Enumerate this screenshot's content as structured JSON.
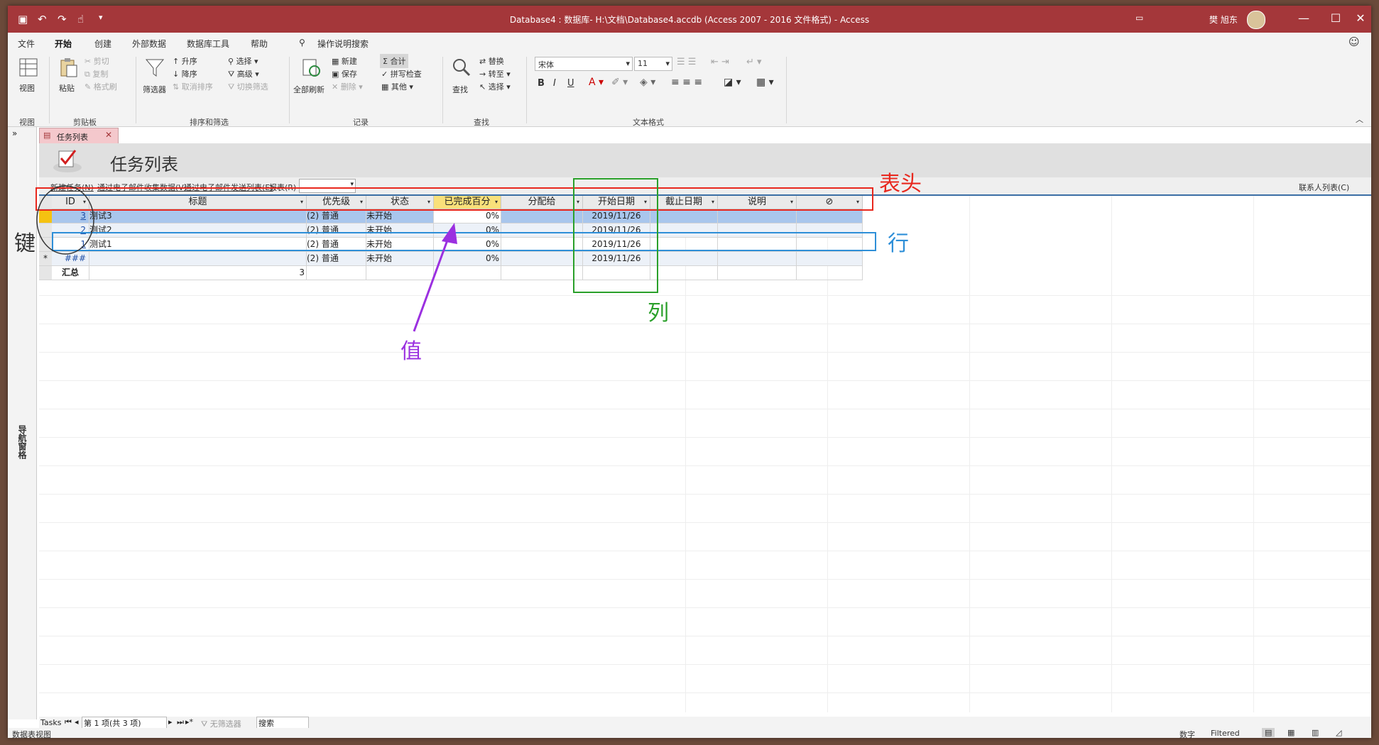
{
  "window": {
    "title": "Database4 : 数据库- H:\\文档\\Database4.accdb (Access 2007 - 2016 文件格式)  -  Access",
    "user": "樊 旭东"
  },
  "ribbon_tabs": [
    "文件",
    "开始",
    "创建",
    "外部数据",
    "数据库工具",
    "帮助"
  ],
  "tell_me": "操作说明搜索",
  "ribbon": {
    "view": "视图",
    "paste": "粘贴",
    "cut": "剪切",
    "copy": "复制",
    "format_painter": "格式刷",
    "filter": "筛选器",
    "ascending": "升序",
    "descending": "降序",
    "remove_sort": "取消排序",
    "selection": "选择",
    "advanced": "高级",
    "toggle_filter": "切换筛选",
    "refresh_all": "全部刷新",
    "new": "新建",
    "save": "保存",
    "delete": "删除",
    "totals": "合计",
    "spelling": "拼写检查",
    "more": "其他",
    "find": "查找",
    "replace": "替换",
    "goto": "转至",
    "select": "选择",
    "font": "宋体",
    "font_size": "11",
    "groups": {
      "views": "视图",
      "clipboard": "剪贴板",
      "sort_filter": "排序和筛选",
      "records": "记录",
      "find": "查找",
      "text_format": "文本格式"
    }
  },
  "document_tab": "任务列表",
  "form_title": "任务列表",
  "nav_pane_label": "导航窗格",
  "subbar": {
    "new_task": "新建任务(N)",
    "collect_email": "通过电子邮件收集数据(V)",
    "send_list": "通过电子邮件发送列表(E)",
    "reports": "报表(R)",
    "contacts": "联系人列表(C)"
  },
  "columns": [
    "ID",
    "标题",
    "优先级",
    "状态",
    "已完成百分",
    "分配给",
    "开始日期",
    "截止日期",
    "说明",
    "⊘"
  ],
  "rows": [
    {
      "id": "3",
      "title": "测试3",
      "priority": "(2) 普通",
      "status": "未开始",
      "pct": "0%",
      "assigned": "",
      "start": "2019/11/26",
      "due": "",
      "desc": ""
    },
    {
      "id": "2",
      "title": "测试2",
      "priority": "(2) 普通",
      "status": "未开始",
      "pct": "0%",
      "assigned": "",
      "start": "2019/11/26",
      "due": "",
      "desc": ""
    },
    {
      "id": "1",
      "title": "测试1",
      "priority": "(2) 普通",
      "status": "未开始",
      "pct": "0%",
      "assigned": "",
      "start": "2019/11/26",
      "due": "",
      "desc": ""
    }
  ],
  "new_row": {
    "id": "###",
    "priority": "(2) 普通",
    "status": "未开始",
    "pct": "0%",
    "start": "2019/11/26"
  },
  "totals_row": {
    "label": "汇总",
    "count": "3"
  },
  "record_nav": {
    "tab": "Tasks",
    "position": "第 1 项(共 3 项)",
    "no_filter": "无筛选器",
    "search": "搜索"
  },
  "status": {
    "left": "数据表视图",
    "numlock": "数字",
    "filtered": "Filtered"
  },
  "annotations": {
    "header": "表头",
    "row": "行",
    "column": "列",
    "value": "值",
    "key": "键"
  },
  "colors": {
    "accent": "#a4373a",
    "header_box": "#e8281e",
    "row_box": "#2e8fd8",
    "column_box": "#2aa02a",
    "value_arrow": "#9b30e0",
    "key_circle": "#333333"
  }
}
